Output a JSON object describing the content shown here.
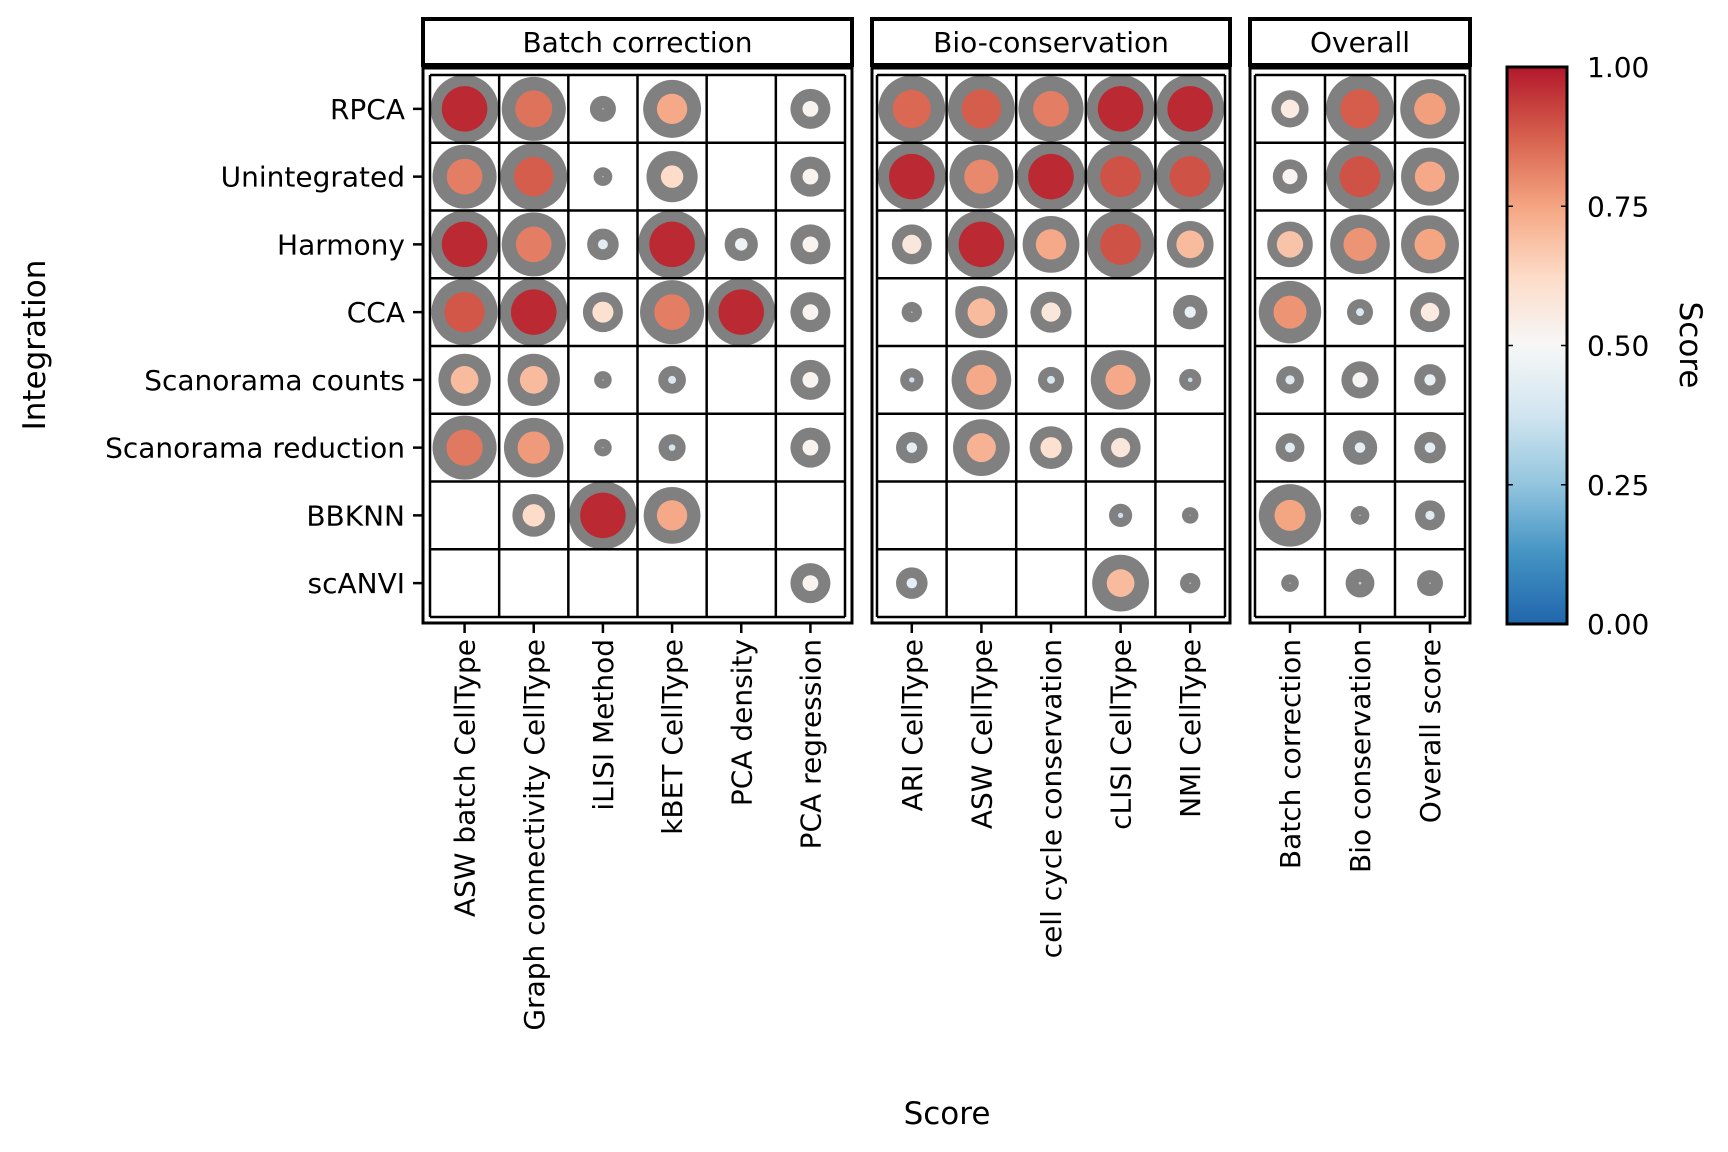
{
  "chart_data": {
    "type": "scatter",
    "subtype": "dot-matrix (faceted bubble heatmap)",
    "title": "",
    "xlabel": "Score",
    "ylabel": "Integration",
    "legend": {
      "title": "Score",
      "placement": "right",
      "type": "colorbar",
      "colormap": "RdBu reversed",
      "range": [
        0,
        1
      ],
      "ticks": [
        "0.00",
        "0.25",
        "0.50",
        "0.75",
        "1.00"
      ],
      "tick_values": [
        0,
        0.25,
        0.5,
        0.75,
        1.0
      ],
      "stops": [
        "#2166ac",
        "#4393c3",
        "#92c5de",
        "#d1e5f0",
        "#f7f7f7",
        "#fddbc7",
        "#f4a582",
        "#d6604d",
        "#b2182b"
      ]
    },
    "encoding": {
      "inner_circle": "score (color and size)",
      "outer_gray_circle": "relative size (0-1)"
    },
    "rows": [
      "RPCA",
      "Unintegrated",
      "Harmony",
      "CCA",
      "Scanorama counts",
      "Scanorama reduction",
      "BBKNN",
      "scANVI"
    ],
    "facets": [
      {
        "name": "Batch correction",
        "columns": [
          "ASW batch CellType",
          "Graph connectivity CellType",
          "iLISI Method",
          "kBET CellType",
          "PCA density",
          "PCA regression"
        ],
        "values": [
          [
            [
              0.97,
              1.0
            ],
            [
              0.84,
              0.93
            ],
            [
              0.3,
              0.25
            ],
            [
              0.74,
              0.82
            ],
            null,
            [
              0.52,
              0.5
            ]
          ],
          [
            [
              0.82,
              0.93
            ],
            [
              0.88,
              0.98
            ],
            [
              0.25,
              0.12
            ],
            [
              0.62,
              0.7
            ],
            null,
            [
              0.52,
              0.5
            ]
          ],
          [
            [
              0.97,
              1.0
            ],
            [
              0.82,
              0.93
            ],
            [
              0.43,
              0.35
            ],
            [
              0.97,
              1.0
            ],
            [
              0.47,
              0.38
            ],
            [
              0.52,
              0.5
            ]
          ],
          [
            [
              0.89,
              0.97
            ],
            [
              0.97,
              1.0
            ],
            [
              0.6,
              0.5
            ],
            [
              0.82,
              0.93
            ],
            [
              0.97,
              1.0
            ],
            [
              0.52,
              0.5
            ]
          ],
          [
            [
              0.7,
              0.72
            ],
            [
              0.7,
              0.72
            ],
            [
              0.25,
              0.1
            ],
            [
              0.4,
              0.28
            ],
            null,
            [
              0.52,
              0.5
            ]
          ],
          [
            [
              0.83,
              0.93
            ],
            [
              0.77,
              0.85
            ],
            [
              0.24,
              0.1
            ],
            [
              0.38,
              0.27
            ],
            null,
            [
              0.52,
              0.5
            ]
          ],
          [
            null,
            [
              0.62,
              0.55
            ],
            [
              0.97,
              1.0
            ],
            [
              0.74,
              0.8
            ],
            null,
            null
          ],
          [
            null,
            null,
            null,
            null,
            null,
            [
              0.52,
              0.5
            ]
          ]
        ]
      },
      {
        "name": "Bio-conservation",
        "columns": [
          "ARI CellType",
          "ASW CellType",
          "cell cycle conservation",
          "cLISI CellType",
          "NMI CellType"
        ],
        "values": [
          [
            [
              0.86,
              0.98
            ],
            [
              0.88,
              0.98
            ],
            [
              0.82,
              0.95
            ],
            [
              0.97,
              1.0
            ],
            [
              0.97,
              1.0
            ]
          ],
          [
            [
              0.97,
              1.0
            ],
            [
              0.8,
              0.93
            ],
            [
              0.97,
              1.0
            ],
            [
              0.9,
              1.0
            ],
            [
              0.9,
              1.0
            ]
          ],
          [
            [
              0.57,
              0.5
            ],
            [
              0.97,
              1.0
            ],
            [
              0.74,
              0.8
            ],
            [
              0.9,
              1.0
            ],
            [
              0.7,
              0.62
            ]
          ],
          [
            [
              0.3,
              0.15
            ],
            [
              0.7,
              0.72
            ],
            [
              0.57,
              0.52
            ],
            null,
            [
              0.45,
              0.4
            ]
          ],
          [
            [
              0.36,
              0.2
            ],
            [
              0.74,
              0.85
            ],
            [
              0.4,
              0.25
            ],
            [
              0.74,
              0.85
            ],
            [
              0.35,
              0.18
            ]
          ],
          [
            [
              0.44,
              0.35
            ],
            [
              0.72,
              0.8
            ],
            [
              0.6,
              0.55
            ],
            [
              0.57,
              0.5
            ],
            null
          ],
          [
            null,
            null,
            null,
            [
              0.36,
              0.2
            ],
            [
              0.22,
              0.08
            ]
          ],
          [
            [
              0.44,
              0.35
            ],
            null,
            null,
            [
              0.7,
              0.8
            ],
            [
              0.3,
              0.15
            ]
          ]
        ]
      },
      {
        "name": "Overall",
        "columns": [
          "Batch correction",
          "Bio conservation",
          "Overall score"
        ],
        "values": [
          [
            [
              0.56,
              0.45
            ],
            [
              0.88,
              1.0
            ],
            [
              0.76,
              0.85
            ]
          ],
          [
            [
              0.51,
              0.4
            ],
            [
              0.9,
              1.0
            ],
            [
              0.74,
              0.82
            ]
          ],
          [
            [
              0.68,
              0.6
            ],
            [
              0.78,
              0.85
            ],
            [
              0.75,
              0.82
            ]
          ],
          [
            [
              0.78,
              0.9
            ],
            [
              0.4,
              0.25
            ],
            [
              0.56,
              0.5
            ]
          ],
          [
            [
              0.42,
              0.28
            ],
            [
              0.51,
              0.45
            ],
            [
              0.45,
              0.35
            ]
          ],
          [
            [
              0.43,
              0.3
            ],
            [
              0.44,
              0.4
            ],
            [
              0.44,
              0.35
            ]
          ],
          [
            [
              0.75,
              0.9
            ],
            [
              0.28,
              0.12
            ],
            [
              0.42,
              0.32
            ]
          ],
          [
            [
              0.25,
              0.1
            ],
            [
              0.32,
              0.3
            ],
            [
              0.29,
              0.25
            ]
          ]
        ]
      }
    ],
    "grid": true
  },
  "colors": {
    "outer_ring": "#808080",
    "grid_line": "#000000",
    "background": "#ffffff"
  }
}
